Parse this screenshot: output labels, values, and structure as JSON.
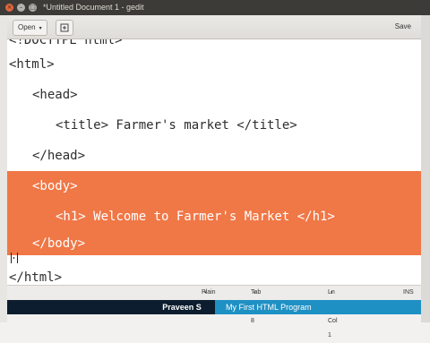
{
  "window": {
    "title": "*Untitled Document 1 - gedit",
    "close_icon": "×",
    "minimize_icon": "–",
    "maximize_icon": "□"
  },
  "toolbar": {
    "open_label": "Open",
    "open_caret": "▾",
    "new_tab_icon": "new-document-icon",
    "save_label": "Save"
  },
  "editor": {
    "lines": [
      "<!DOCTYPE html>",
      "<html>",
      "<head>",
      "<title> Farmer's market </title>",
      "</head>",
      "<body>",
      "<h1> Welcome to Farmer's Market </h1>",
      "</body>",
      "</html>"
    ],
    "selection_color": "#f07746"
  },
  "statusbar": {
    "language": "Plain Text",
    "tab_width": "Tab Width: 8",
    "position": "Ln 16, Col 1",
    "mode": "INS"
  },
  "caption": {
    "name": "Praveen S",
    "program_title": "My First HTML Program",
    "band_color": "#0b1d2e",
    "title_color": "#1f90c4"
  }
}
